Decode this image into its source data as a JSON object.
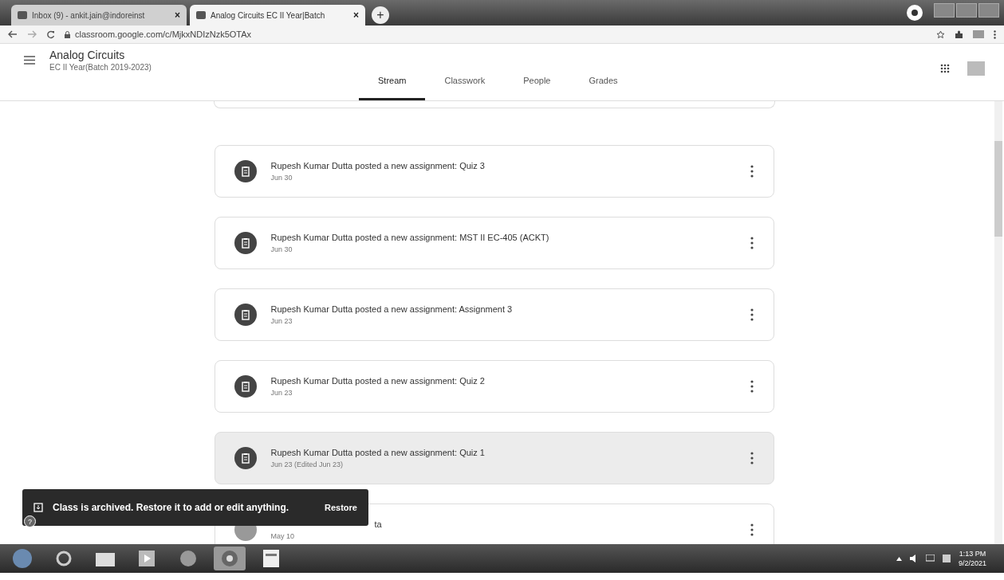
{
  "browser_tabs": [
    {
      "title": "Inbox (9) - ankit.jain@indoreinst",
      "close": "×",
      "selected": false
    },
    {
      "title": "Analog Circuits EC II Year|Batch",
      "close": "×",
      "selected": true
    }
  ],
  "new_tab": "+",
  "address": "classroom.google.com/c/MjkxNDIzNzk5OTAx",
  "class_header": {
    "title": "Analog Circuits",
    "subtitle": "EC II Year(Batch 2019-2023)"
  },
  "nav_tabs": [
    {
      "label": "Stream",
      "selected": true
    },
    {
      "label": "Classwork",
      "selected": false
    },
    {
      "label": "People",
      "selected": false
    },
    {
      "label": "Grades",
      "selected": false
    }
  ],
  "posts": [
    {
      "kind": "assignment",
      "title": "Rupesh Kumar Dutta posted a new assignment: Quiz 3",
      "date": "Jun 30",
      "highlighted": false
    },
    {
      "kind": "assignment",
      "title": "Rupesh Kumar Dutta posted a new assignment: MST II EC-405 (ACKT)",
      "date": "Jun 30",
      "highlighted": false
    },
    {
      "kind": "assignment",
      "title": "Rupesh Kumar Dutta posted a new assignment: Assignment 3",
      "date": "Jun 23",
      "highlighted": false
    },
    {
      "kind": "assignment",
      "title": "Rupesh Kumar Dutta posted a new assignment: Quiz 2",
      "date": "Jun 23",
      "highlighted": false
    },
    {
      "kind": "assignment",
      "title": "Rupesh Kumar Dutta posted a new assignment: Quiz 1",
      "date": "Jun 23 (Edited Jun 23)",
      "highlighted": true
    },
    {
      "kind": "person",
      "title": "ta",
      "date": "May 10",
      "highlighted": false
    }
  ],
  "toast": {
    "message": "Class is archived. Restore it to add or edit anything.",
    "action": "Restore"
  },
  "help": "?",
  "clock": {
    "time": "1:13 PM",
    "date": "9/2/2021"
  }
}
